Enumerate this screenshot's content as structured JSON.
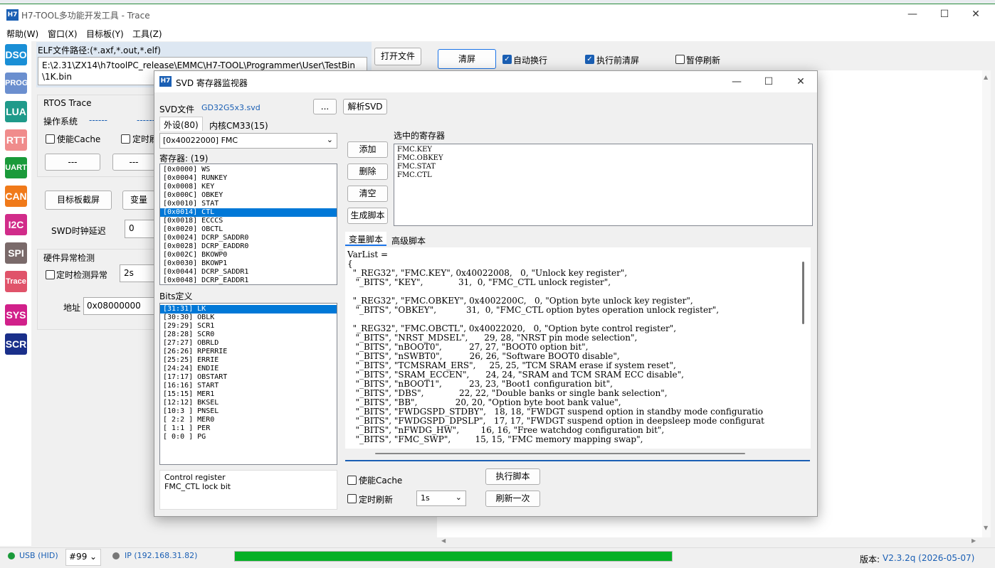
{
  "app": {
    "title": "H7-TOOL多功能开发工具 - Trace",
    "icon": "H7"
  },
  "menu": [
    "帮助(W)",
    "窗口(X)",
    "目标板(Y)",
    "工具(Z)"
  ],
  "sidebar": [
    "DSO",
    "PROG",
    "LUA",
    "RTT",
    "UART",
    "CAN",
    "I2C",
    "SPI",
    "Trace",
    "SYS",
    "SCR"
  ],
  "sidebar_colors": [
    "#1a8fd6",
    "#6b8fcf",
    "#1f9a8a",
    "#f08c8c",
    "#1a9a3a",
    "#f07a1a",
    "#d12c8a",
    "#7a6a6a",
    "#e0536a",
    "#d1208a",
    "#1a2f8a"
  ],
  "elf": {
    "label": "ELF文件路径:(*.axf,*.out,*.elf)",
    "path_line1": "E:\\2.31\\ZX14\\h7toolPC_release\\EMMC\\H7-TOOL\\Programmer\\User\\TestBin",
    "path_line2": "\\1K.bin",
    "open_button": "打开文件"
  },
  "rtos": {
    "title": "RTOS Trace",
    "os_label": "操作系统",
    "os_value": "------",
    "os_value2": "------",
    "cache_label": "使能Cache",
    "timer_label": "定时刷",
    "btn1": "---",
    "btn2": "---"
  },
  "target": {
    "screenshot_button": "目标板截屏",
    "var_button": "变量"
  },
  "swd": {
    "label": "SWD时钟延迟",
    "value": "0"
  },
  "hw": {
    "title": "硬件异常检测",
    "check_label": "定时检测异常",
    "interval": "2s",
    "addr_label": "地址",
    "addr_value": "0x08000000"
  },
  "toolbar": {
    "clear_button": "清屏",
    "auto_wrap": "自动换行",
    "clear_before": "执行前清屏",
    "pause": "暂停刷新"
  },
  "svd": {
    "title": "SVD 寄存器监视器",
    "icon": "H7",
    "file_label": "SVD文件",
    "file_value": "GD32G5x3.svd",
    "browse_button": "...",
    "parse_button": "解析SVD",
    "tabs": [
      "外设(80)",
      "内核CM33(15)"
    ],
    "peripheral": "[0x40022000] FMC",
    "regs_label": "寄存器: (19)",
    "registers": [
      "[0x0000] WS",
      "[0x0004] RUNKEY",
      "[0x0008] KEY",
      "[0x000C] OBKEY",
      "[0x0010] STAT",
      "[0x0014] CTL",
      "[0x0018] ECCCS",
      "[0x0020] OBCTL",
      "[0x0024] DCRP_SADDR0",
      "[0x0028] DCRP_EADDR0",
      "[0x002C] BKOWP0",
      "[0x0030] BKOWP1",
      "[0x0044] DCRP_SADDR1",
      "[0x0048] DCRP_EADDR1"
    ],
    "selected_register_index": 5,
    "bits_label": "Bits定义",
    "bits": [
      "[31:31] LK",
      "[30:30] OBLK",
      "[29:29] SCR1",
      "[28:28] SCR0",
      "[27:27] OBRLD",
      "[26:26] RPERRIE",
      "[25:25] ERRIE",
      "[24:24] ENDIE",
      "[17:17] OBSTART",
      "[16:16] START",
      "[15:15] MER1",
      "[12:12] BKSEL",
      "[10:3 ] PNSEL",
      "[ 2:2 ] MER0",
      "[ 1:1 ] PER",
      "[ 0:0 ] PG"
    ],
    "selected_bit_index": 0,
    "desc_line1": "Control register",
    "desc_line2": "FMC_CTL lock bit",
    "add_button": "添加",
    "delete_button": "删除",
    "clear_button": "清空",
    "gen_button": "生成脚本",
    "selected_label": "选中的寄存器",
    "selected": [
      "FMC.KEY",
      "FMC.OBKEY",
      "FMC.STAT",
      "FMC.CTL"
    ],
    "script_tabs": [
      "变量脚本",
      "高级脚本"
    ],
    "code": "VarList =\n{\n  \"_REG32\", \"FMC.KEY\", 0x40022008,   0, \"Unlock key register\",\n   \"_BITS\", \"KEY\",             31,  0, \"FMC_CTL unlock register\",\n\n  \"_REG32\", \"FMC.OBKEY\", 0x4002200C,   0, \"Option byte unlock key register\",\n   \"_BITS\", \"OBKEY\",           31,  0, \"FMC_CTL option bytes operation unlock register\",\n\n  \"_REG32\", \"FMC.OBCTL\", 0x40022020,   0, \"Option byte control register\",\n   \"_BITS\", \"NRST_MDSEL\",      29, 28, \"NRST pin mode selection\",\n   \"_BITS\", \"nBOOT0\",          27, 27, \"BOOT0 option bit\",\n   \"_BITS\", \"nSWBT0\",          26, 26, \"Software BOOT0 disable\",\n   \"_BITS\", \"TCMSRAM_ERS\",     25, 25, \"TCM SRAM erase if system reset\",\n   \"_BITS\", \"SRAM_ECCEN\",      24, 24, \"SRAM and TCM SRAM ECC disable\",\n   \"_BITS\", \"nBOOT1\",          23, 23, \"Boot1 configuration bit\",\n   \"_BITS\", \"DBS\",             22, 22, \"Double banks or single bank selection\",\n   \"_BITS\", \"BB\",              20, 20, \"Option byte boot bank value\",\n   \"_BITS\", \"FWDGSPD_STDBY\",   18, 18, \"FWDGT suspend option in standby mode configuratio\n   \"_BITS\", \"FWDGSPD_DPSLP\",   17, 17, \"FWDGT suspend option in deepsleep mode configurat\n   \"_BITS\", \"nFWDG_HW\",        16, 16, \"Free watchdog configuration bit\",\n   \"_BITS\", \"FMC_SWP\",         15, 15, \"FMC memory mapping swap\",",
    "cache_label": "使能Cache",
    "timer_label": "定时刷新",
    "interval": "1s",
    "exec_button": "执行脚本",
    "refresh_button": "刷新一次"
  },
  "status": {
    "usb": "USB (HID)",
    "device": "#99",
    "ip": "IP (192.168.31.82)",
    "progress": 1.0,
    "version_label": "版本:",
    "version": "V2.3.2q (2026-05-07)"
  }
}
